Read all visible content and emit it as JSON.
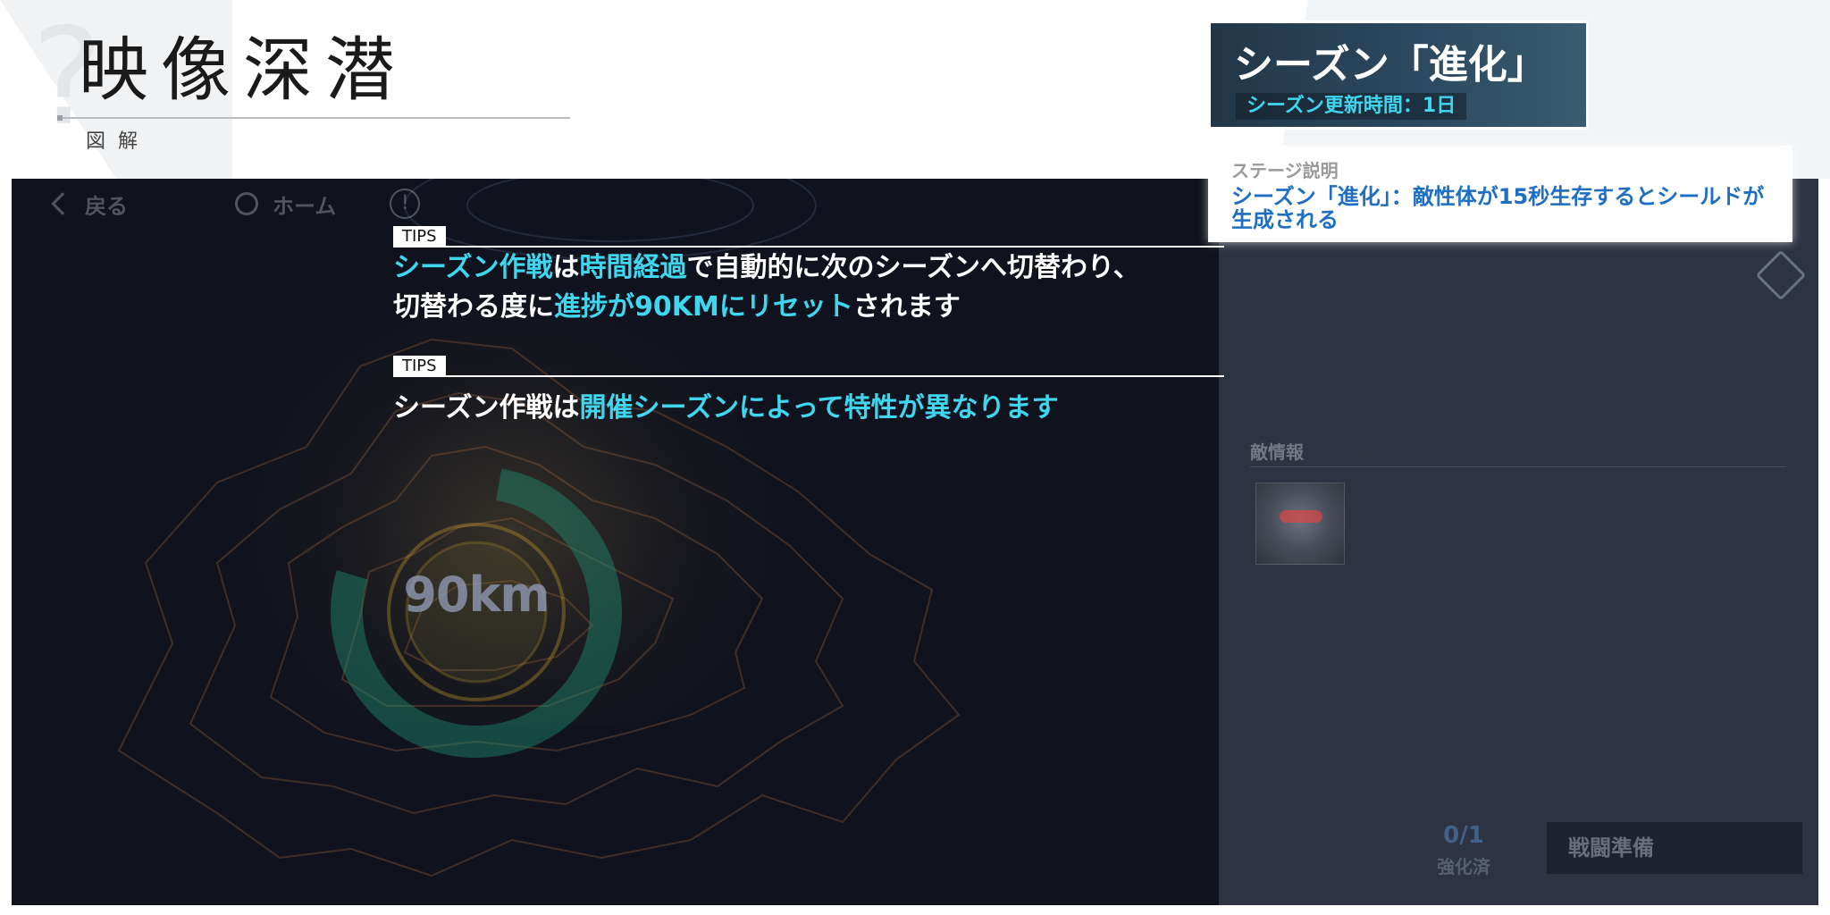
{
  "header": {
    "title": "映像深潜",
    "subtitle": "図解"
  },
  "nav": {
    "back_label": "戻る",
    "home_label": "ホーム"
  },
  "map": {
    "distance_label": "90km"
  },
  "tips": [
    {
      "tag": "TIPS",
      "line1": [
        {
          "text": "シーズン作戦",
          "hl": true
        },
        {
          "text": "は",
          "hl": false
        },
        {
          "text": "時間経過",
          "hl": true
        },
        {
          "text": "で自動的に次のシーズンへ切替わり、",
          "hl": false
        }
      ],
      "line2": [
        {
          "text": "切替わる度に",
          "hl": false
        },
        {
          "text": "進捗が90KMにリセット",
          "hl": true
        },
        {
          "text": "されます",
          "hl": false
        }
      ]
    },
    {
      "tag": "TIPS",
      "line1": [
        {
          "text": "シーズン作戦は",
          "hl": false
        },
        {
          "text": "開催シーズンによって特性が異なります",
          "hl": true
        }
      ]
    }
  ],
  "season": {
    "title": "シーズン「進化」",
    "update_time": "シーズン更新時間：1日"
  },
  "stage": {
    "label": "ステージ説明",
    "description": "シーズン「進化」：敵性体が15秒生存するとシールドが生成される"
  },
  "enemy": {
    "label": "敵情報"
  },
  "progress": {
    "value": "0/1",
    "label": "強化済"
  },
  "battle_button": {
    "label": "戦闘準備"
  },
  "colors": {
    "highlight": "#3fd6f0",
    "stage_text": "#1e6fc4",
    "panel_bg": "#10131d"
  }
}
